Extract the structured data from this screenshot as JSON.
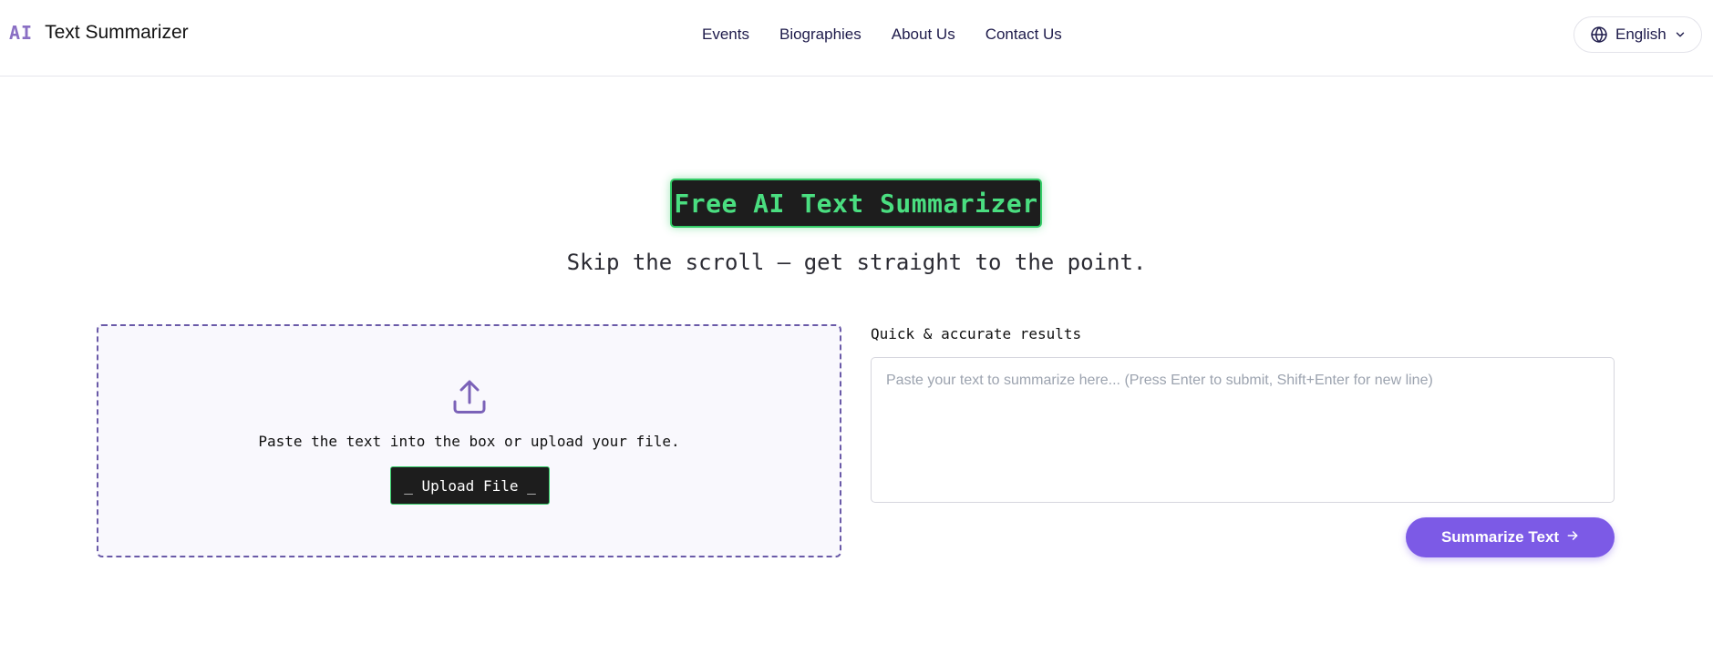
{
  "header": {
    "brand_mark": "AI",
    "brand_name": "Text Summarizer",
    "nav": [
      "Events",
      "Biographies",
      "About Us",
      "Contact Us"
    ],
    "language": "English"
  },
  "hero": {
    "title": "Free AI Text Summarizer",
    "subtitle": "Skip the scroll — get straight to the point."
  },
  "upload": {
    "instruction": "Paste the text into the box or upload your file.",
    "button_label": "_ Upload File _"
  },
  "input": {
    "label": "Quick & accurate results",
    "value": "",
    "placeholder": "Paste your text to summarize here... (Press Enter to submit, Shift+Enter for new line)"
  },
  "actions": {
    "summarize_label": "Summarize Text"
  },
  "icons": {
    "language": "globe-icon",
    "language_toggle": "chevron-down-icon",
    "upload": "upload-icon",
    "summarize": "arrow-right-icon"
  },
  "colors": {
    "accent": "#7c5ae6",
    "badge_green": "#4ade80",
    "badge_bg": "#1d1d1d",
    "dropzone_border": "#6a5aa8"
  }
}
